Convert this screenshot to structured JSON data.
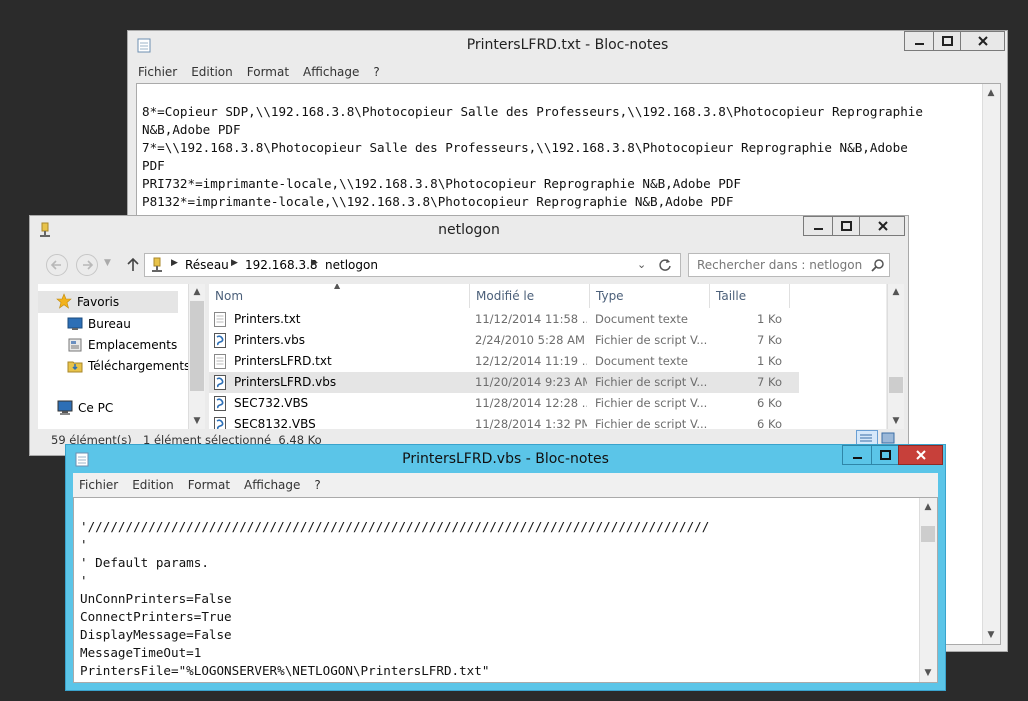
{
  "notepad_txt": {
    "title": "PrintersLFRD.txt - Bloc-notes",
    "menu": [
      "Fichier",
      "Edition",
      "Format",
      "Affichage",
      "?"
    ],
    "lines": [
      "8*=Copieur SDP,\\\\192.168.3.8\\Photocopieur Salle des Professeurs,\\\\192.168.3.8\\Photocopieur Reprographie",
      "N&B,Adobe PDF",
      "7*=\\\\192.168.3.8\\Photocopieur Salle des Professeurs,\\\\192.168.3.8\\Photocopieur Reprographie N&B,Adobe",
      "PDF",
      "PRI732*=imprimante-locale,\\\\192.168.3.8\\Photocopieur Reprographie N&B,Adobe PDF",
      "P8132*=imprimante-locale,\\\\192.168.3.8\\Photocopieur Reprographie N&B,Adobe PDF"
    ]
  },
  "explorer": {
    "title": "netlogon",
    "breadcrumb": [
      "Réseau",
      "192.168.3.8",
      "netlogon"
    ],
    "search_placeholder": "Rechercher dans : netlogon",
    "nav": {
      "favorites": "Favoris",
      "items": [
        "Bureau",
        "Emplacements ré",
        "Téléchargements"
      ],
      "pc": "Ce PC"
    },
    "columns": [
      "Nom",
      "Modifié le",
      "Type",
      "Taille"
    ],
    "files": [
      {
        "name": "Printers.txt",
        "date": "11/12/2014 11:58 ...",
        "type": "Document texte",
        "size": "1 Ko",
        "kind": "txt"
      },
      {
        "name": "Printers.vbs",
        "date": "2/24/2010 5:28 AM",
        "type": "Fichier de script V...",
        "size": "7 Ko",
        "kind": "vbs"
      },
      {
        "name": "PrintersLFRD.txt",
        "date": "12/12/2014 11:19 ...",
        "type": "Document texte",
        "size": "1 Ko",
        "kind": "txt"
      },
      {
        "name": "PrintersLFRD.vbs",
        "date": "11/20/2014 9:23 AM",
        "type": "Fichier de script V...",
        "size": "7 Ko",
        "kind": "vbs",
        "selected": true
      },
      {
        "name": "SEC732.VBS",
        "date": "11/28/2014 12:28 ...",
        "type": "Fichier de script V...",
        "size": "6 Ko",
        "kind": "vbs"
      },
      {
        "name": "SEC8132.VBS",
        "date": "11/28/2014 1:32 PM",
        "type": "Fichier de script V...",
        "size": "6 Ko",
        "kind": "vbs"
      }
    ],
    "status_count": "59 élément(s)",
    "status_selection": "1 élément sélectionné  6,48 Ko"
  },
  "notepad_vbs": {
    "title": "PrintersLFRD.vbs - Bloc-notes",
    "menu": [
      "Fichier",
      "Edition",
      "Format",
      "Affichage",
      "?"
    ],
    "lines": [
      "'//////////////////////////////////////////////////////////////////////////////////",
      "'",
      "' Default params.",
      "'",
      "UnConnPrinters=False",
      "ConnectPrinters=True",
      "DisplayMessage=False",
      "MessageTimeOut=1",
      "PrintersFile=\"%LOGONSERVER%\\NETLOGON\\PrintersLFRD.txt\"",
      "'"
    ]
  },
  "colors": {
    "inactive_frame": "#ebebeb",
    "active_frame": "#5bc5e8",
    "close_red": "#c7403a"
  }
}
